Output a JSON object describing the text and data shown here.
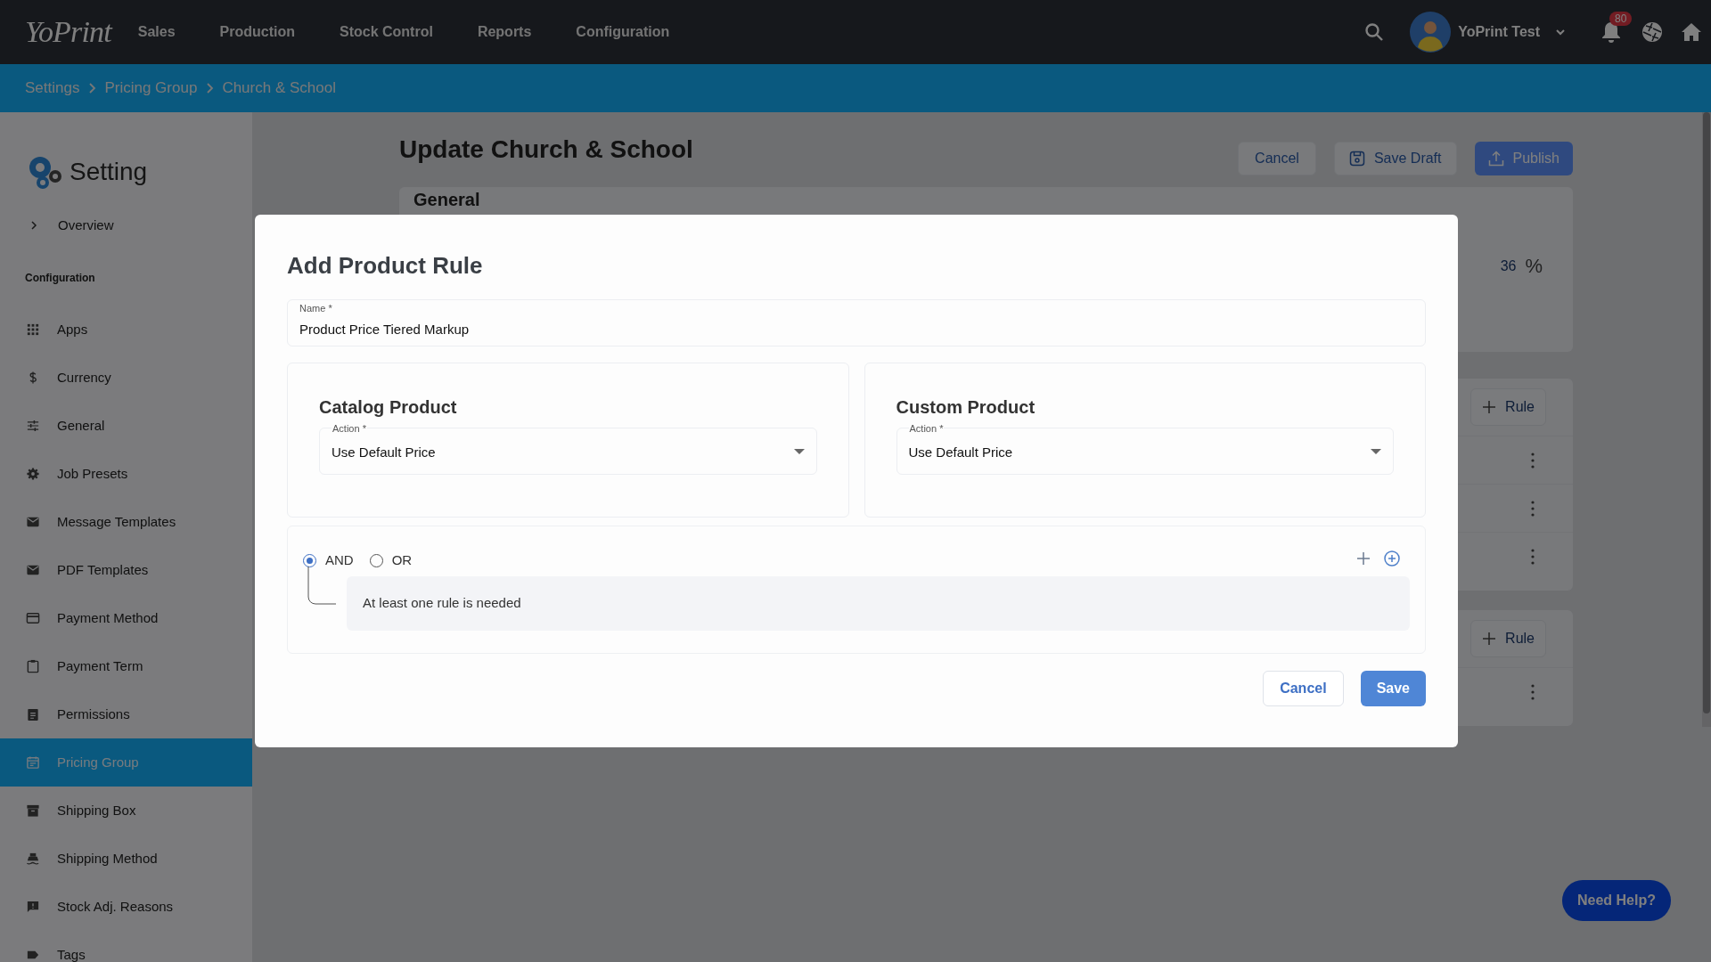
{
  "top_nav": {
    "logo": "YoPrint",
    "items": [
      "Sales",
      "Production",
      "Stock Control",
      "Reports",
      "Configuration"
    ],
    "user": "YoPrint Test",
    "notification_count": "80"
  },
  "breadcrumb": [
    "Settings",
    "Pricing Group",
    "Church & School"
  ],
  "sidebar": {
    "title": "Setting",
    "overview": "Overview",
    "section": "Configuration",
    "items": [
      {
        "label": "Apps",
        "kind": "grid",
        "selected": false
      },
      {
        "label": "Currency",
        "kind": "dollar",
        "selected": false
      },
      {
        "label": "General",
        "kind": "sliders",
        "selected": false
      },
      {
        "label": "Job Presets",
        "kind": "gear",
        "selected": false
      },
      {
        "label": "Message Templates",
        "kind": "mail",
        "selected": false
      },
      {
        "label": "PDF Templates",
        "kind": "mail",
        "selected": false
      },
      {
        "label": "Payment Method",
        "kind": "card",
        "selected": false
      },
      {
        "label": "Payment Term",
        "kind": "clipboard",
        "selected": false
      },
      {
        "label": "Permissions",
        "kind": "list",
        "selected": false
      },
      {
        "label": "Pricing Group",
        "kind": "calendar",
        "selected": true
      },
      {
        "label": "Shipping Box",
        "kind": "archive",
        "selected": false
      },
      {
        "label": "Shipping Method",
        "kind": "ship",
        "selected": false
      },
      {
        "label": "Stock Adj. Reasons",
        "kind": "feedback",
        "selected": false
      },
      {
        "label": "Tags",
        "kind": "tag",
        "selected": false
      }
    ]
  },
  "page": {
    "title": "Update Church & School",
    "buttons": [
      {
        "label": "Cancel",
        "kind": "plain"
      },
      {
        "label": "Save Draft",
        "kind": "draft"
      },
      {
        "label": "Publish",
        "kind": "primary"
      }
    ],
    "general": {
      "title": "General",
      "value": "36",
      "unit": "%"
    },
    "rule_groups": [
      {
        "button": "Rule",
        "rows": [
          {
            "kind": "menu"
          },
          {
            "kind": "menu"
          },
          {
            "kind": "menu"
          }
        ]
      },
      {
        "button": "Rule",
        "rows": [
          {
            "kind": "menu"
          }
        ]
      }
    ]
  },
  "modal": {
    "title": "Add Product Rule",
    "name_field": {
      "label": "Name *",
      "value": "Product Price Tiered Markup"
    },
    "panels": [
      {
        "title": "Catalog Product",
        "action_label": "Action *",
        "action_value": "Use Default Price"
      },
      {
        "title": "Custom Product",
        "action_label": "Action *",
        "action_value": "Use Default Price"
      }
    ],
    "combinator": [
      {
        "label": "AND",
        "selected": true
      },
      {
        "label": "OR",
        "selected": false
      }
    ],
    "empty_message": "At least one rule is needed",
    "buttons": [
      {
        "label": "Cancel",
        "kind": "secondary"
      },
      {
        "label": "Save",
        "kind": "primary"
      }
    ]
  },
  "help_button": "Need Help?"
}
